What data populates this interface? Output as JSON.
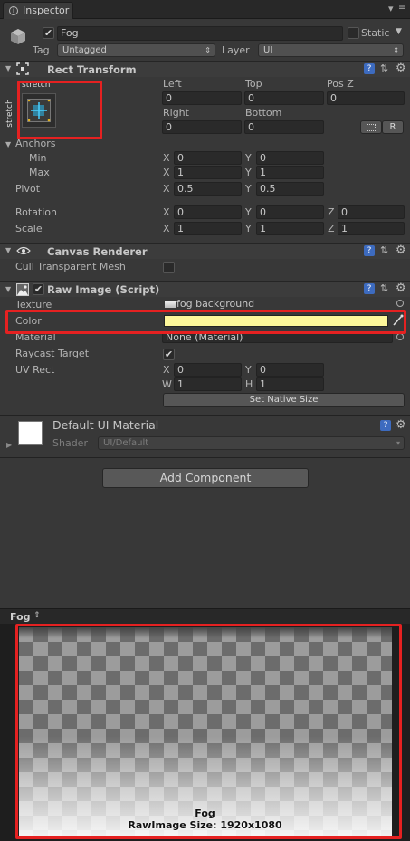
{
  "tab": {
    "title": "Inspector"
  },
  "object": {
    "name": "Fog",
    "static_label": "Static",
    "tag_label": "Tag",
    "tag_value": "Untagged",
    "layer_label": "Layer",
    "layer_value": "UI"
  },
  "rect_transform": {
    "title": "Rect Transform",
    "anchor_preset_top": "stretch",
    "anchor_preset_side": "stretch",
    "cols": [
      "Left",
      "Top",
      "Pos Z"
    ],
    "row1": [
      "0",
      "0",
      "0"
    ],
    "cols2": [
      "Right",
      "Bottom"
    ],
    "row2": [
      "0",
      "0"
    ],
    "r_button": "R",
    "anchors_label": "Anchors",
    "min_label": "Min",
    "min_x": "0",
    "min_y": "0",
    "max_label": "Max",
    "max_x": "1",
    "max_y": "1",
    "pivot_label": "Pivot",
    "pivot_x": "0.5",
    "pivot_y": "0.5",
    "rotation_label": "Rotation",
    "rot_x": "0",
    "rot_y": "0",
    "rot_z": "0",
    "scale_label": "Scale",
    "scale_x": "1",
    "scale_y": "1",
    "scale_z": "1",
    "axis_x": "X",
    "axis_y": "Y",
    "axis_z": "Z",
    "axis_w": "W",
    "axis_h": "H"
  },
  "canvas_renderer": {
    "title": "Canvas Renderer",
    "cull_label": "Cull Transparent Mesh"
  },
  "raw_image": {
    "title": "Raw Image (Script)",
    "texture_label": "Texture",
    "texture_value": "fog background",
    "color_label": "Color",
    "color_value": "#fdf79a",
    "material_label": "Material",
    "material_value": "None (Material)",
    "raycast_label": "Raycast Target",
    "uvrect_label": "UV Rect",
    "uv_x": "0",
    "uv_y": "0",
    "uv_w": "1",
    "uv_h": "1",
    "native_size_button": "Set Native Size"
  },
  "material": {
    "name": "Default UI Material",
    "shader_label": "Shader",
    "shader_value": "UI/Default"
  },
  "add_component": "Add Component",
  "preview": {
    "title": "Fog",
    "caption_name": "Fog",
    "caption_size": "RawImage Size: 1920x1080"
  }
}
